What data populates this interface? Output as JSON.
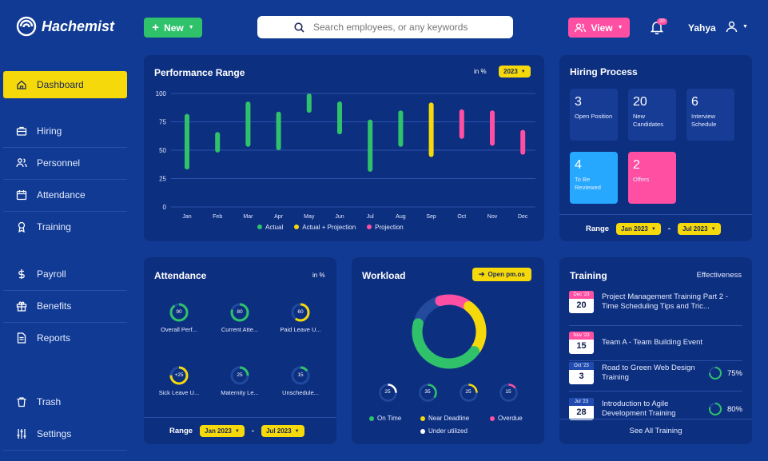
{
  "app": {
    "name": "Hachemist"
  },
  "header": {
    "new_label": "New",
    "search_placeholder": "Search employees, or any keywords",
    "view_label": "View",
    "notif_count": "20",
    "user_name": "Yahya"
  },
  "sidebar": {
    "items": [
      {
        "label": "Dashboard",
        "icon": "home-icon"
      },
      {
        "label": "Hiring",
        "icon": "briefcase-icon"
      },
      {
        "label": "Personnel",
        "icon": "users-icon"
      },
      {
        "label": "Attendance",
        "icon": "calendar-icon"
      },
      {
        "label": "Training",
        "icon": "award-icon"
      },
      {
        "label": "Payroll",
        "icon": "dollar-icon"
      },
      {
        "label": "Benefits",
        "icon": "gift-icon"
      },
      {
        "label": "Reports",
        "icon": "document-icon"
      },
      {
        "label": "Trash",
        "icon": "trash-icon"
      },
      {
        "label": "Settings",
        "icon": "sliders-icon"
      }
    ]
  },
  "performance": {
    "title": "Performance Range",
    "unit": "in %",
    "year": "2023"
  },
  "chart_data": {
    "type": "bar",
    "title": "Performance Range",
    "categories": [
      "Jan",
      "Feb",
      "Mar",
      "Apr",
      "May",
      "Jun",
      "Jul",
      "Aug",
      "Sep",
      "Oct",
      "Nov",
      "Dec"
    ],
    "yticks": [
      "100",
      "75",
      "50",
      "25",
      "0"
    ],
    "ylim": [
      0,
      100
    ],
    "series": [
      {
        "name": "Actual",
        "color": "#2fc26b",
        "ranges": [
          [
            33,
            82
          ],
          [
            48,
            66
          ],
          [
            53,
            93
          ],
          [
            50,
            84
          ],
          [
            83,
            100
          ],
          [
            64,
            93
          ],
          [
            31,
            77
          ],
          [
            53,
            85
          ],
          null,
          null,
          null,
          null
        ]
      },
      {
        "name": "Actual + Projection",
        "color": "#f5d90a",
        "ranges": [
          null,
          null,
          null,
          null,
          null,
          null,
          null,
          null,
          [
            44,
            92
          ],
          null,
          null,
          null
        ]
      },
      {
        "name": "Projection",
        "color": "#ff4fa3",
        "ranges": [
          null,
          null,
          null,
          null,
          null,
          null,
          null,
          null,
          null,
          [
            60,
            86
          ],
          [
            54,
            85
          ],
          [
            46,
            68
          ]
        ]
      }
    ],
    "grid": true,
    "legend": "bottom"
  },
  "hiring": {
    "title": "Hiring Process",
    "stats": [
      {
        "num": "3",
        "label": "Open Position"
      },
      {
        "num": "20",
        "label": "New Candidates"
      },
      {
        "num": "6",
        "label": "Interview Schedule"
      },
      {
        "num": "4",
        "label": "To Be Reviewed"
      },
      {
        "num": "2",
        "label": "Offers"
      }
    ],
    "range_label": "Range",
    "range_from": "Jan 2023",
    "range_to": "Jul 2023",
    "range_sep": "-"
  },
  "attendance": {
    "title": "Attendance",
    "unit": "in %",
    "rings": [
      {
        "value": "90",
        "pct": 90,
        "label": "Overall Perf...",
        "color": "#2fc26b"
      },
      {
        "value": "80",
        "pct": 80,
        "label": "Current Atte...",
        "color": "#2fc26b"
      },
      {
        "value": "60",
        "pct": 60,
        "label": "Paid Leave U...",
        "color": "#f5d90a"
      },
      {
        "value": "+25",
        "pct": 75,
        "label": "Sick Leave U...",
        "color": "#f5d90a"
      },
      {
        "value": "25",
        "pct": 25,
        "label": "Maternity Le...",
        "color": "#2fc26b"
      },
      {
        "value": "15",
        "pct": 15,
        "label": "Unschedule...",
        "color": "#2fc26b"
      }
    ],
    "range_label": "Range",
    "range_from": "Jan 2023",
    "range_to": "Jul 2023",
    "range_sep": "-"
  },
  "workload": {
    "title": "Workload",
    "open_label": "Open pm.os",
    "donut": [
      {
        "name": "On Time",
        "pct": 45,
        "color": "#2fc26b"
      },
      {
        "name": "Near Deadline",
        "pct": 25,
        "color": "#f5d90a"
      },
      {
        "name": "Overdue",
        "pct": 15,
        "color": "#ff4fa3"
      },
      {
        "name": "Under utilized",
        "pct": 15,
        "color": "#244a9e"
      }
    ],
    "minis": [
      {
        "value": "25",
        "pct": 25,
        "color": "#ffffff"
      },
      {
        "value": "35",
        "pct": 35,
        "color": "#2fc26b"
      },
      {
        "value": "25",
        "pct": 25,
        "color": "#f5d90a"
      },
      {
        "value": "15",
        "pct": 15,
        "color": "#ff4fa3"
      }
    ],
    "legend": [
      {
        "name": "On Time",
        "color": "#2fc26b"
      },
      {
        "name": "Near Deadline",
        "color": "#f5d90a"
      },
      {
        "name": "Overdue",
        "color": "#ff4fa3"
      },
      {
        "name": "Under utilized",
        "color": "#ffffff"
      }
    ]
  },
  "training": {
    "title": "Training",
    "subtitle": "Effectiveness",
    "items": [
      {
        "month": "Dec '23",
        "day": "20",
        "mcolor": "#ff4fa3",
        "text": "Project Management Training Part 2 - Time Scheduling Tips and Tric...",
        "pct": ""
      },
      {
        "month": "Nov '23",
        "day": "15",
        "mcolor": "#ff4fa3",
        "text": "Team A - Team Building Event",
        "pct": ""
      },
      {
        "month": "Oct '23",
        "day": "3",
        "mcolor": "#1f4bb0",
        "text": "Road to Green Web Design Training",
        "pct": "75%"
      },
      {
        "month": "Jul '23",
        "day": "28",
        "mcolor": "#1f4bb0",
        "text": "Introduction to Agile Development Training",
        "pct": "80%"
      }
    ],
    "see_all": "See All Training"
  }
}
